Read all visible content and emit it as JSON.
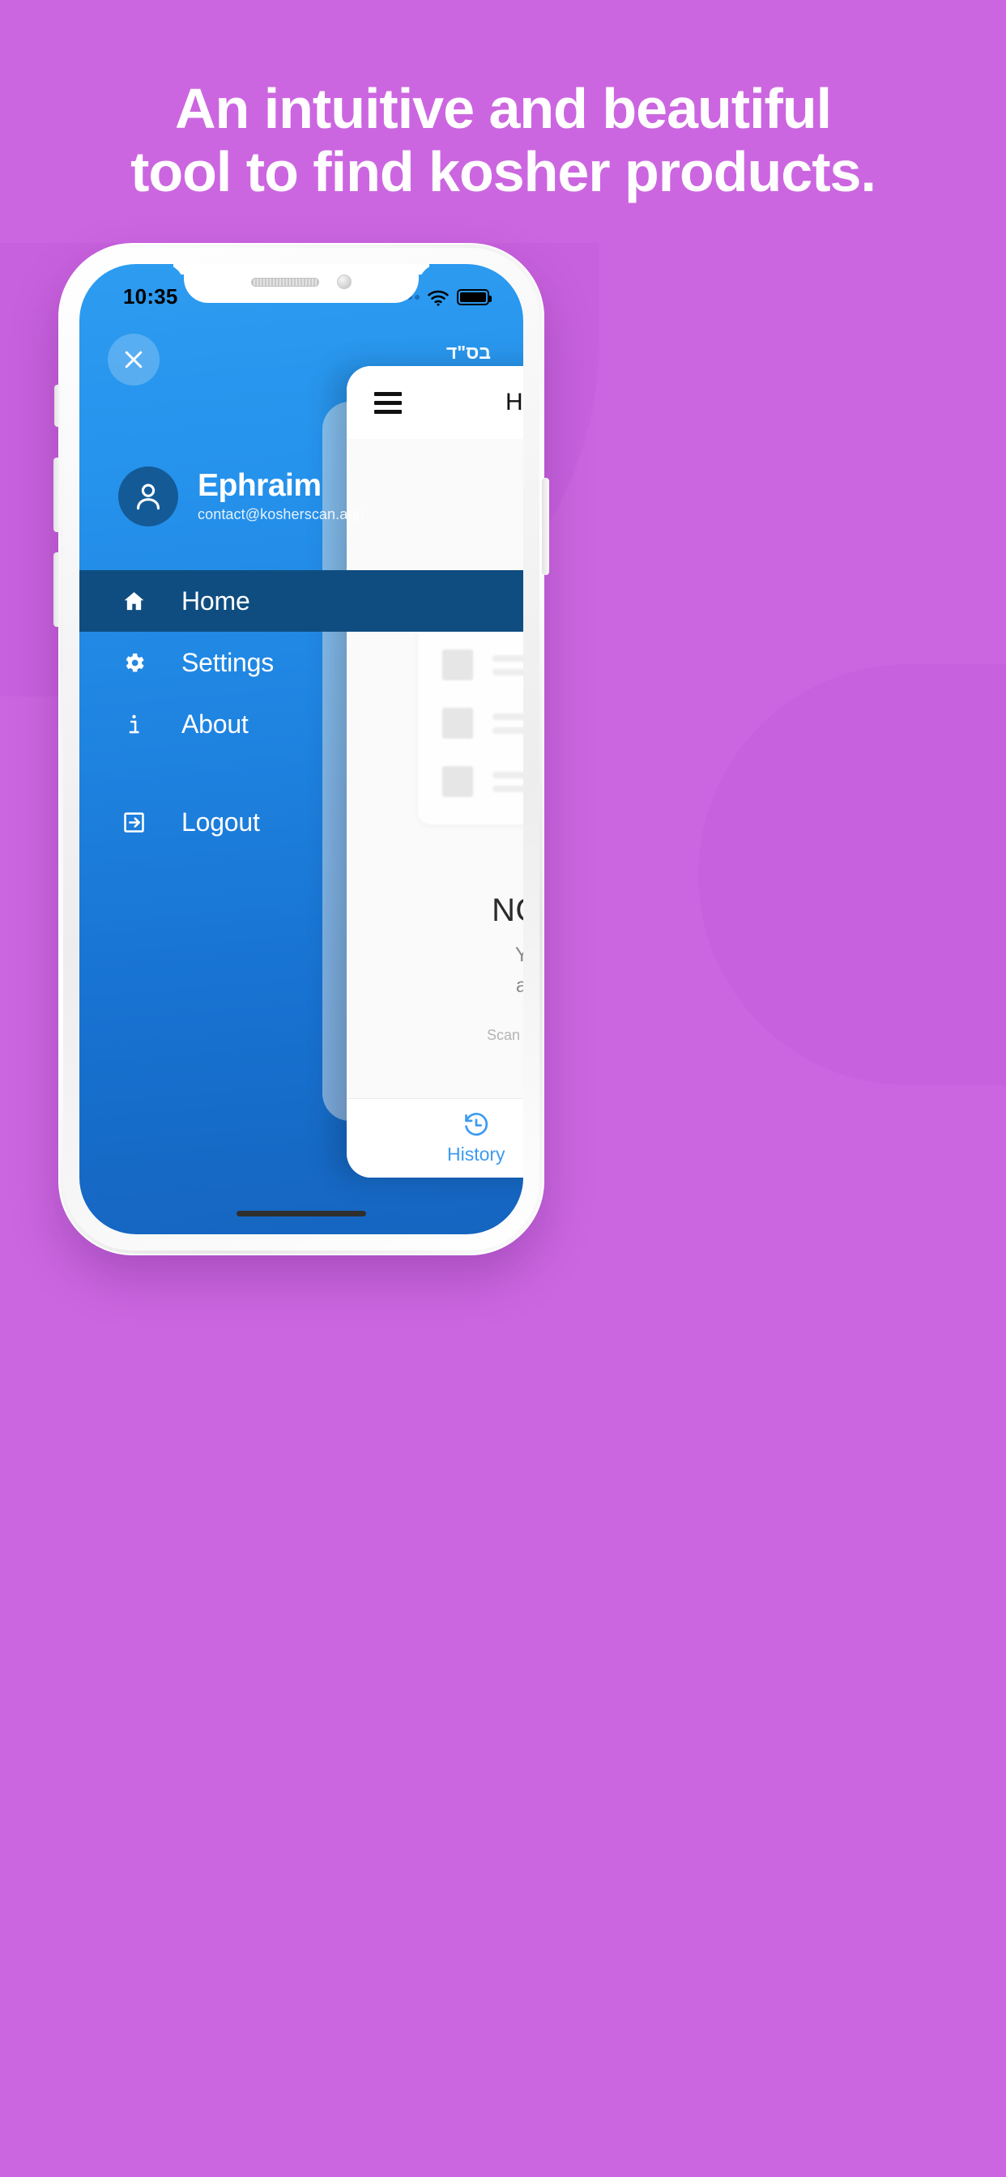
{
  "colors": {
    "background_purple": "#CC66E0",
    "drawer_blue_top": "#2D9CF0",
    "drawer_blue_bottom": "#1565C0",
    "active_item": "#0F4D80",
    "accent_blue": "#3D9BF0"
  },
  "headline": {
    "line1": "An intuitive and beautiful",
    "line2": "tool to find kosher products."
  },
  "phone": {
    "statusbar": {
      "time": "10:35",
      "wifi_icon": "wifi-icon",
      "battery_icon": "battery-full-icon",
      "signal_icon": "signal-dots-icon"
    },
    "home_indicator": "home-indicator"
  },
  "drawer": {
    "close_icon": "close-icon",
    "bsd_text": "בס\"ד",
    "profile": {
      "avatar_icon": "person-icon",
      "name": "Ephraim",
      "email": "contact@kosherscan.app"
    },
    "items": [
      {
        "label": "Home",
        "icon": "home-icon",
        "active": true
      },
      {
        "label": "Settings",
        "icon": "gear-icon",
        "active": false
      },
      {
        "label": "About",
        "icon": "info-icon",
        "active": false
      },
      {
        "label": "Logout",
        "icon": "logout-icon",
        "active": false
      }
    ]
  },
  "content_panel": {
    "menu_icon": "hamburger-menu-icon",
    "title": "H",
    "skeleton_rows": 3,
    "empty_state": {
      "title": "NO P",
      "line1": "You",
      "line2": "any",
      "hint": "Scan the prod"
    },
    "tabs": [
      {
        "label": "History",
        "icon": "history-clock-icon",
        "active": true
      }
    ]
  }
}
